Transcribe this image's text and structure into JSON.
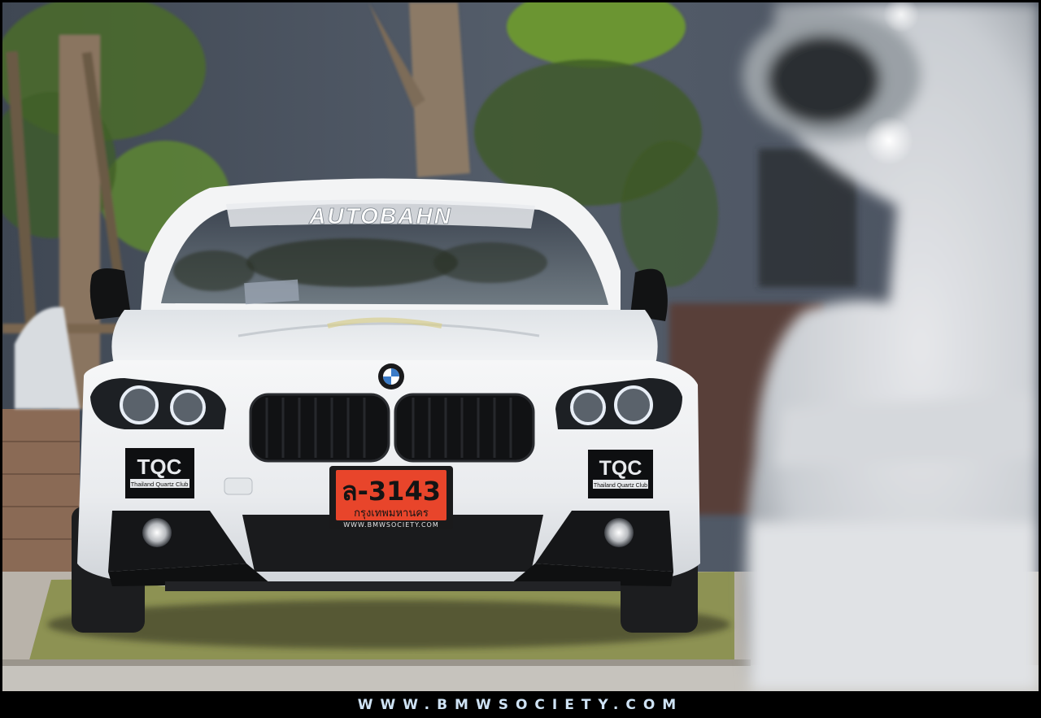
{
  "windshield_banner": "AUTOBAHN",
  "license_plate": {
    "number": "ล-3143",
    "province": "กรุงเทพมหานคร",
    "frame_text": "WWW.BMWSOCIETY.COM"
  },
  "badge": {
    "logo": "TQC",
    "name": "Thailand Quartz Club"
  },
  "footer": {
    "site": "WWW.BMWSOCIETY.COM"
  },
  "colors": {
    "car_body": "#eef0f2",
    "plate": "#e8452b",
    "footer_text": "#cfe3f5",
    "wall": "#4a5360",
    "grass": "#8a9050"
  }
}
